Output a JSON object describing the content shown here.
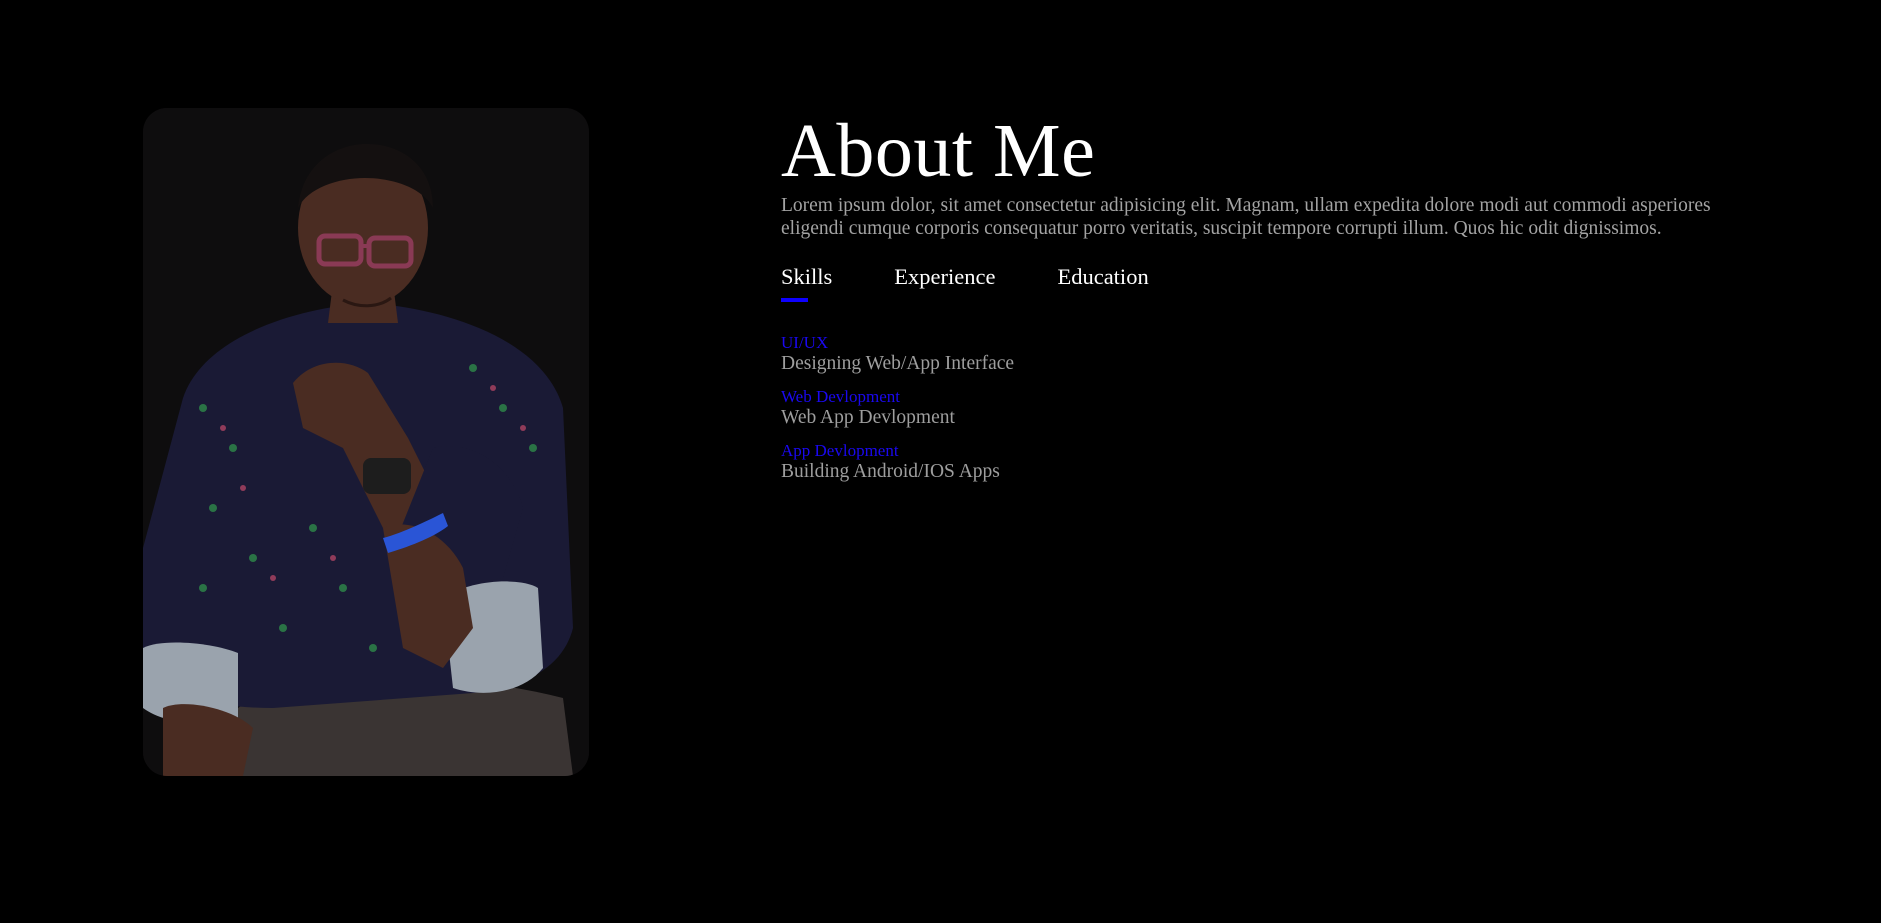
{
  "photo": {
    "alt": "Portrait photo",
    "colors": {
      "card_bg": "#0e0d0e",
      "shirt": "#1a1a35",
      "skin": "#4a2c22",
      "glasses": "#8a3a55",
      "wristband": "#2a55d6",
      "pants": "#3a3433"
    }
  },
  "about": {
    "title": "About Me",
    "text": "Lorem ipsum dolor, sit amet consectetur adipisicing elit. Magnam, ullam expedita dolore modi aut commodi asperiores eligendi cumque corporis consequatur porro veritatis, suscipit tempore corrupti illum. Quos hic odit dignissimos."
  },
  "tabs": [
    {
      "label": "Skills",
      "active": true
    },
    {
      "label": "Experience",
      "active": false
    },
    {
      "label": "Education",
      "active": false
    }
  ],
  "skills": [
    {
      "name": "UI/UX",
      "desc": "Designing Web/App Interface"
    },
    {
      "name": "Web Devlopment",
      "desc": "Web App Devlopment"
    },
    {
      "name": "App Devlopment",
      "desc": "Building Android/IOS Apps"
    }
  ],
  "colors": {
    "background": "#000000",
    "accent": "#0d00ff",
    "heading": "#ffffff",
    "body_text": "#a3a3a3"
  }
}
